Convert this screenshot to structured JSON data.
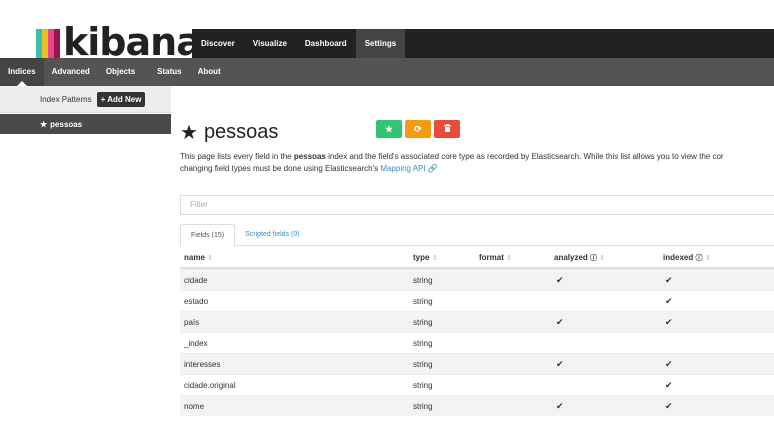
{
  "brand": {
    "name": "kibana",
    "bar_colors": [
      "#3ebeb0",
      "#e6c220",
      "#e8488b",
      "#9a1452"
    ]
  },
  "main_nav": [
    {
      "label": "Discover",
      "active": false
    },
    {
      "label": "Visualize",
      "active": false
    },
    {
      "label": "Dashboard",
      "active": false
    },
    {
      "label": "Settings",
      "active": true
    }
  ],
  "sub_nav": [
    {
      "label": "Indices",
      "active": true
    },
    {
      "label": "Advanced",
      "active": false
    },
    {
      "label": "Objects",
      "active": false
    },
    {
      "label": "Status",
      "active": false
    },
    {
      "label": "About",
      "active": false
    }
  ],
  "sidebar": {
    "header_label": "Index Patterns",
    "add_button": "+ Add New",
    "items": [
      {
        "label": "pessoas",
        "default": true
      }
    ]
  },
  "page": {
    "title": "pessoas",
    "desc_part1": "This page lists every field in the ",
    "desc_bold": "pessoas",
    "desc_part2": " index and the field's associated core type as recorded by Elasticsearch. While this list allows you to view the cor",
    "desc_line2": "changing field types must be done using Elasticsearch's ",
    "desc_link": "Mapping API",
    "filter_placeholder": "Filter"
  },
  "tabs": [
    {
      "label": "Fields (15)",
      "active": true
    },
    {
      "label": "Scripted fields (0)",
      "active": false
    }
  ],
  "table": {
    "headers": {
      "name": "name",
      "type": "type",
      "format": "format",
      "analyzed": "analyzed",
      "indexed": "indexed"
    },
    "rows": [
      {
        "name": "cidade",
        "type": "string",
        "format": "",
        "analyzed": true,
        "indexed": true
      },
      {
        "name": "estado",
        "type": "string",
        "format": "",
        "analyzed": false,
        "indexed": true
      },
      {
        "name": "país",
        "type": "string",
        "format": "",
        "analyzed": true,
        "indexed": true
      },
      {
        "name": "_index",
        "type": "string",
        "format": "",
        "analyzed": false,
        "indexed": false
      },
      {
        "name": "interesses",
        "type": "string",
        "format": "",
        "analyzed": true,
        "indexed": true
      },
      {
        "name": "cidade.original",
        "type": "string",
        "format": "",
        "analyzed": false,
        "indexed": true
      },
      {
        "name": "nome",
        "type": "string",
        "format": "",
        "analyzed": true,
        "indexed": true
      }
    ]
  },
  "colors": {
    "accent_link": "#3a8fc4",
    "btn_default": "#31c471",
    "btn_refresh": "#f39c12",
    "btn_delete": "#e74c3c"
  }
}
